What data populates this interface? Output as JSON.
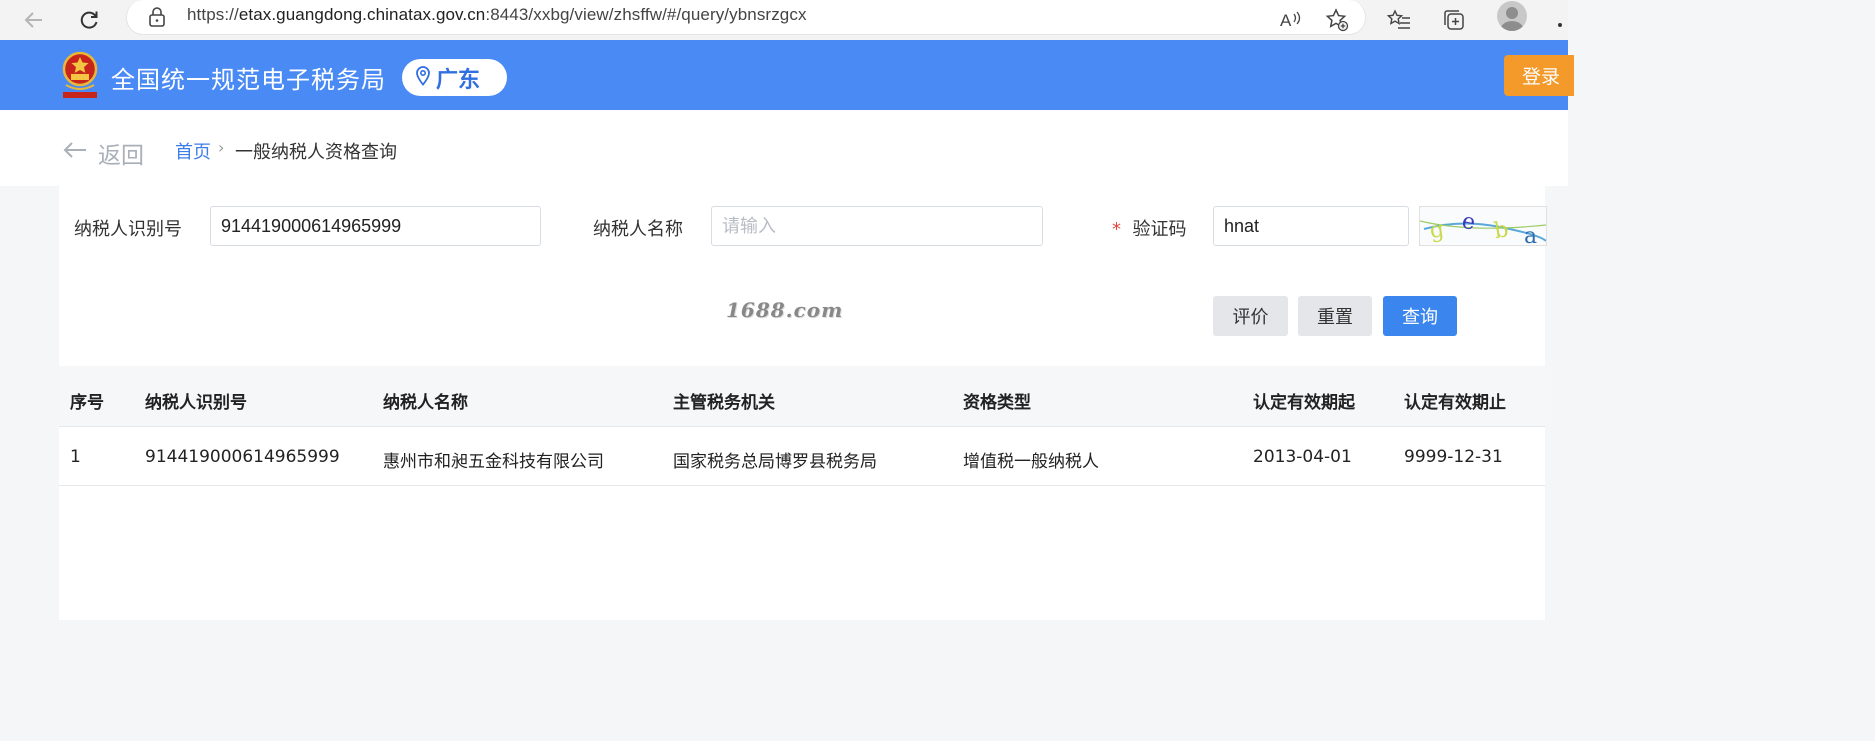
{
  "browser": {
    "url_prefix": "https://",
    "url_host": "etax.guangdong.chinatax.gov.cn",
    "url_rest": ":8443/xxbg/view/zhsffw/#/query/ybnsrzgcx"
  },
  "header": {
    "title": "全国统一规范电子税务局",
    "region": "广东",
    "login": "登录"
  },
  "breadcrumb": {
    "back": "返回",
    "home": "首页",
    "separator": "›",
    "current": "一般纳税人资格查询"
  },
  "form": {
    "taxpayer_id_label": "纳税人识别号",
    "taxpayer_id_value": "914419000614965999",
    "taxpayer_name_label": "纳税人名称",
    "taxpayer_name_placeholder": "请输入",
    "captcha_required_mark": "*",
    "captcha_label": "验证码",
    "captcha_value": "hnat"
  },
  "watermark": "1688.com",
  "buttons": {
    "evaluate": "评价",
    "reset": "重置",
    "query": "查询"
  },
  "table": {
    "columns": [
      "序号",
      "纳税人识别号",
      "纳税人名称",
      "主管税务机关",
      "资格类型",
      "认定有效期起",
      "认定有效期止"
    ],
    "rows": [
      [
        "1",
        "914419000614965999",
        "惠州市和昶五金科技有限公司",
        "国家税务总局博罗县税务局",
        "增值税一般纳税人",
        "2013-04-01",
        "9999-12-31"
      ]
    ]
  },
  "colors": {
    "header_bg": "#4a8af4",
    "login_bg": "#f39a2b",
    "primary": "#3b86ee"
  }
}
